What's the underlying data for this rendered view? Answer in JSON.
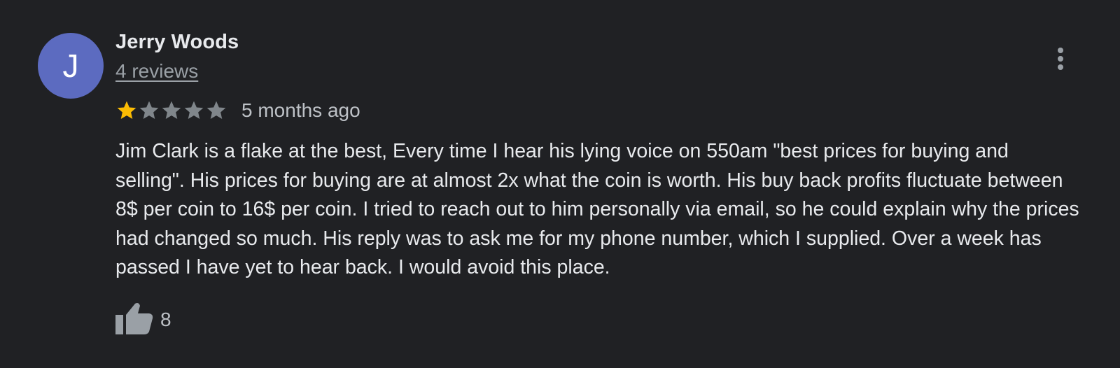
{
  "review": {
    "avatar_letter": "J",
    "avatar_color": "#5c6bc0",
    "author_name": "Jerry Woods",
    "reviews_count_label": "4 reviews",
    "rating": 1,
    "rating_max": 5,
    "star_filled_color": "#fbbc04",
    "star_empty_color": "#80868b",
    "time_ago": "5 months ago",
    "text": "Jim Clark is a flake at the best, Every time I hear his lying voice on 550am \"best prices for buying and selling\". His prices for buying are at almost 2x what the coin is worth. His buy back profits fluctuate between 8$ per coin to 16$ per coin. I tried to reach out to him personally via email, so he could explain why the prices had changed so much. His reply was to ask me for my phone number, which I supplied. Over a week has passed I have yet to hear back. I would avoid this place.",
    "like_count": "8",
    "icons": {
      "more": "more-vert-icon",
      "like": "thumb-up-icon",
      "star": "star-icon"
    }
  }
}
